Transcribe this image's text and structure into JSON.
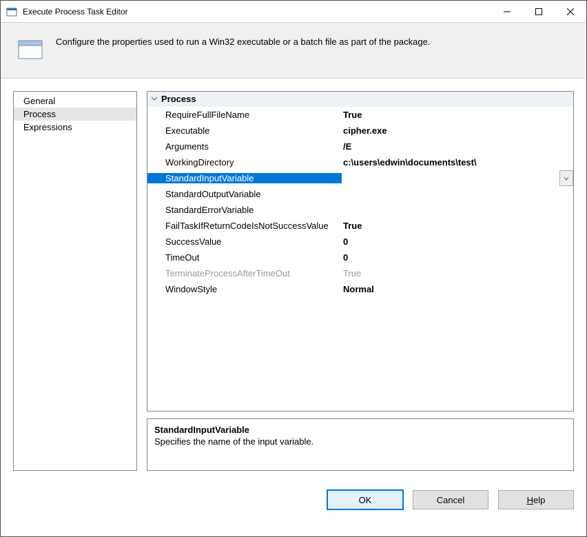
{
  "window": {
    "title": "Execute Process Task Editor"
  },
  "description": "Configure the properties used to run a Win32 executable or a batch file as part of the package.",
  "categories": {
    "general": "General",
    "process": "Process",
    "expressions": "Expressions"
  },
  "selectedCategory": "process",
  "propGrid": {
    "groupLabel": "Process",
    "rows": {
      "requireFullFileName": {
        "name": "RequireFullFileName",
        "value": "True"
      },
      "executable": {
        "name": "Executable",
        "value": "cipher.exe"
      },
      "arguments": {
        "name": "Arguments",
        "value": "/E"
      },
      "workingDirectory": {
        "name": "WorkingDirectory",
        "value": "c:\\users\\edwin\\documents\\test\\"
      },
      "standardInputVariable": {
        "name": "StandardInputVariable",
        "value": ""
      },
      "standardOutputVariable": {
        "name": "StandardOutputVariable",
        "value": ""
      },
      "standardErrorVariable": {
        "name": "StandardErrorVariable",
        "value": ""
      },
      "failTaskIfReturnCodeIsNotSuccessValue": {
        "name": "FailTaskIfReturnCodeIsNotSuccessValue",
        "value": "True"
      },
      "successValue": {
        "name": "SuccessValue",
        "value": "0"
      },
      "timeOut": {
        "name": "TimeOut",
        "value": "0"
      },
      "terminateProcessAfterTimeOut": {
        "name": "TerminateProcessAfterTimeOut",
        "value": "True"
      },
      "windowStyle": {
        "name": "WindowStyle",
        "value": "Normal"
      }
    }
  },
  "help": {
    "title": "StandardInputVariable",
    "body": "Specifies the name of the input variable."
  },
  "buttons": {
    "ok": "OK",
    "cancel": "Cancel",
    "help_prefix": "H",
    "help_rest": "elp"
  }
}
